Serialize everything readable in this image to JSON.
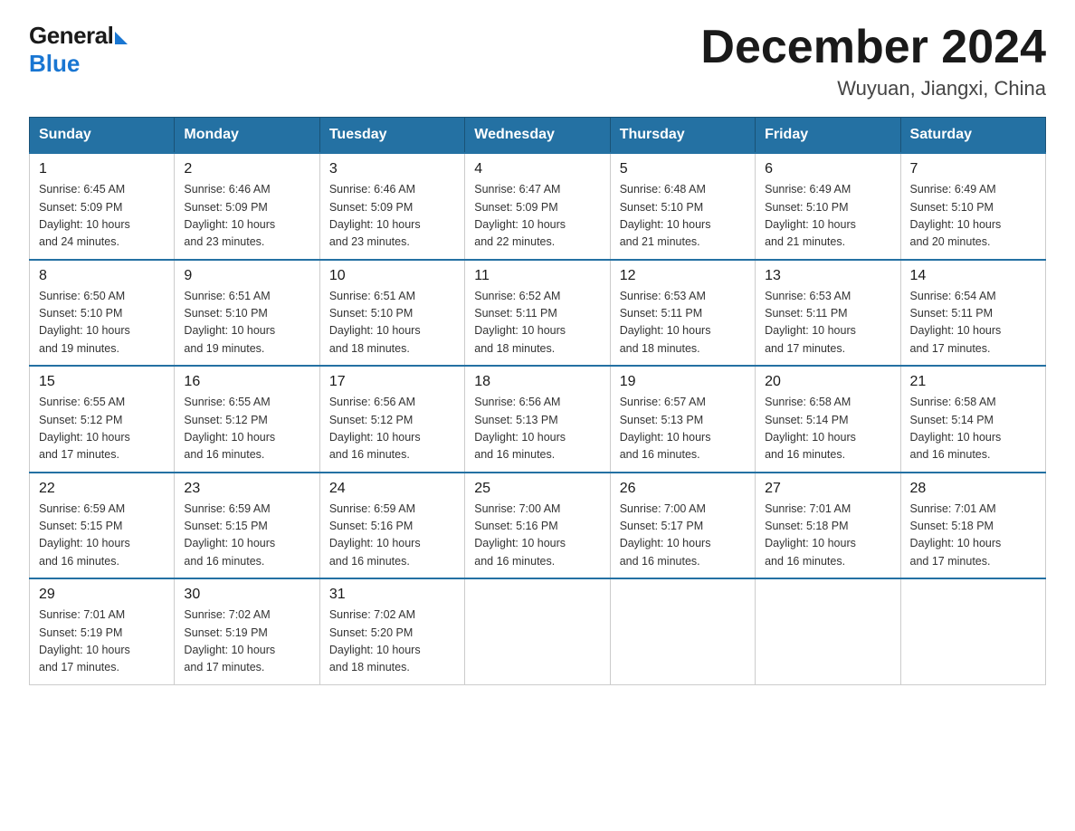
{
  "logo": {
    "general": "General",
    "blue": "Blue"
  },
  "header": {
    "title": "December 2024",
    "subtitle": "Wuyuan, Jiangxi, China"
  },
  "days_of_week": [
    "Sunday",
    "Monday",
    "Tuesday",
    "Wednesday",
    "Thursday",
    "Friday",
    "Saturday"
  ],
  "weeks": [
    [
      {
        "day": "1",
        "sunrise": "6:45 AM",
        "sunset": "5:09 PM",
        "daylight": "10 hours and 24 minutes."
      },
      {
        "day": "2",
        "sunrise": "6:46 AM",
        "sunset": "5:09 PM",
        "daylight": "10 hours and 23 minutes."
      },
      {
        "day": "3",
        "sunrise": "6:46 AM",
        "sunset": "5:09 PM",
        "daylight": "10 hours and 23 minutes."
      },
      {
        "day": "4",
        "sunrise": "6:47 AM",
        "sunset": "5:09 PM",
        "daylight": "10 hours and 22 minutes."
      },
      {
        "day": "5",
        "sunrise": "6:48 AM",
        "sunset": "5:10 PM",
        "daylight": "10 hours and 21 minutes."
      },
      {
        "day": "6",
        "sunrise": "6:49 AM",
        "sunset": "5:10 PM",
        "daylight": "10 hours and 21 minutes."
      },
      {
        "day": "7",
        "sunrise": "6:49 AM",
        "sunset": "5:10 PM",
        "daylight": "10 hours and 20 minutes."
      }
    ],
    [
      {
        "day": "8",
        "sunrise": "6:50 AM",
        "sunset": "5:10 PM",
        "daylight": "10 hours and 19 minutes."
      },
      {
        "day": "9",
        "sunrise": "6:51 AM",
        "sunset": "5:10 PM",
        "daylight": "10 hours and 19 minutes."
      },
      {
        "day": "10",
        "sunrise": "6:51 AM",
        "sunset": "5:10 PM",
        "daylight": "10 hours and 18 minutes."
      },
      {
        "day": "11",
        "sunrise": "6:52 AM",
        "sunset": "5:11 PM",
        "daylight": "10 hours and 18 minutes."
      },
      {
        "day": "12",
        "sunrise": "6:53 AM",
        "sunset": "5:11 PM",
        "daylight": "10 hours and 18 minutes."
      },
      {
        "day": "13",
        "sunrise": "6:53 AM",
        "sunset": "5:11 PM",
        "daylight": "10 hours and 17 minutes."
      },
      {
        "day": "14",
        "sunrise": "6:54 AM",
        "sunset": "5:11 PM",
        "daylight": "10 hours and 17 minutes."
      }
    ],
    [
      {
        "day": "15",
        "sunrise": "6:55 AM",
        "sunset": "5:12 PM",
        "daylight": "10 hours and 17 minutes."
      },
      {
        "day": "16",
        "sunrise": "6:55 AM",
        "sunset": "5:12 PM",
        "daylight": "10 hours and 16 minutes."
      },
      {
        "day": "17",
        "sunrise": "6:56 AM",
        "sunset": "5:12 PM",
        "daylight": "10 hours and 16 minutes."
      },
      {
        "day": "18",
        "sunrise": "6:56 AM",
        "sunset": "5:13 PM",
        "daylight": "10 hours and 16 minutes."
      },
      {
        "day": "19",
        "sunrise": "6:57 AM",
        "sunset": "5:13 PM",
        "daylight": "10 hours and 16 minutes."
      },
      {
        "day": "20",
        "sunrise": "6:58 AM",
        "sunset": "5:14 PM",
        "daylight": "10 hours and 16 minutes."
      },
      {
        "day": "21",
        "sunrise": "6:58 AM",
        "sunset": "5:14 PM",
        "daylight": "10 hours and 16 minutes."
      }
    ],
    [
      {
        "day": "22",
        "sunrise": "6:59 AM",
        "sunset": "5:15 PM",
        "daylight": "10 hours and 16 minutes."
      },
      {
        "day": "23",
        "sunrise": "6:59 AM",
        "sunset": "5:15 PM",
        "daylight": "10 hours and 16 minutes."
      },
      {
        "day": "24",
        "sunrise": "6:59 AM",
        "sunset": "5:16 PM",
        "daylight": "10 hours and 16 minutes."
      },
      {
        "day": "25",
        "sunrise": "7:00 AM",
        "sunset": "5:16 PM",
        "daylight": "10 hours and 16 minutes."
      },
      {
        "day": "26",
        "sunrise": "7:00 AM",
        "sunset": "5:17 PM",
        "daylight": "10 hours and 16 minutes."
      },
      {
        "day": "27",
        "sunrise": "7:01 AM",
        "sunset": "5:18 PM",
        "daylight": "10 hours and 16 minutes."
      },
      {
        "day": "28",
        "sunrise": "7:01 AM",
        "sunset": "5:18 PM",
        "daylight": "10 hours and 17 minutes."
      }
    ],
    [
      {
        "day": "29",
        "sunrise": "7:01 AM",
        "sunset": "5:19 PM",
        "daylight": "10 hours and 17 minutes."
      },
      {
        "day": "30",
        "sunrise": "7:02 AM",
        "sunset": "5:19 PM",
        "daylight": "10 hours and 17 minutes."
      },
      {
        "day": "31",
        "sunrise": "7:02 AM",
        "sunset": "5:20 PM",
        "daylight": "10 hours and 18 minutes."
      },
      null,
      null,
      null,
      null
    ]
  ],
  "labels": {
    "sunrise": "Sunrise:",
    "sunset": "Sunset:",
    "daylight": "Daylight:"
  }
}
